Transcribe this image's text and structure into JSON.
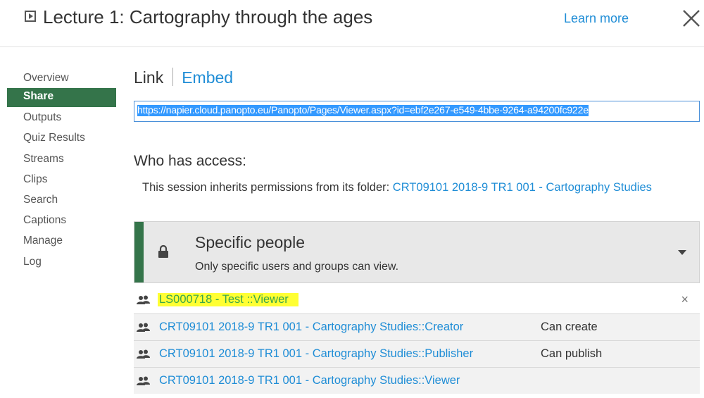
{
  "header": {
    "title": "Lecture 1: Cartography through the ages",
    "learn_more": "Learn more"
  },
  "sidebar": {
    "items": [
      {
        "label": "Overview"
      },
      {
        "label": "Share"
      },
      {
        "label": "Outputs"
      },
      {
        "label": "Quiz Results"
      },
      {
        "label": "Streams"
      },
      {
        "label": "Clips"
      },
      {
        "label": "Search"
      },
      {
        "label": "Captions"
      },
      {
        "label": "Manage"
      },
      {
        "label": "Log"
      }
    ],
    "active": "Share"
  },
  "share": {
    "tab_link": "Link",
    "tab_embed": "Embed",
    "url": "https://napier.cloud.panopto.eu/Panopto/Pages/Viewer.aspx?id=ebf2e267-e549-4bbe-9264-a94200fc922e",
    "who_has_access": "Who has access:",
    "inherit_text": "This session inherits permissions from its folder: ",
    "folder_link": "CRT09101 2018-9 TR1 001 - Cartography Studies",
    "access_level": {
      "title": "Specific people",
      "description": "Only specific users and groups can view."
    },
    "permissions": [
      {
        "name": "LS000718 - Test ::Viewer",
        "role": "",
        "removable": true
      },
      {
        "name": "CRT09101 2018-9 TR1 001 - Cartography Studies::Creator",
        "role": "Can create"
      },
      {
        "name": "CRT09101 2018-9 TR1 001 - Cartography Studies::Publisher",
        "role": "Can publish"
      },
      {
        "name": "CRT09101 2018-9 TR1 001 - Cartography Studies::Viewer",
        "role": ""
      }
    ]
  },
  "colors": {
    "accent_green": "#34744a",
    "link_blue": "#1f8dd6",
    "highlight_yellow": "#ffff33"
  }
}
